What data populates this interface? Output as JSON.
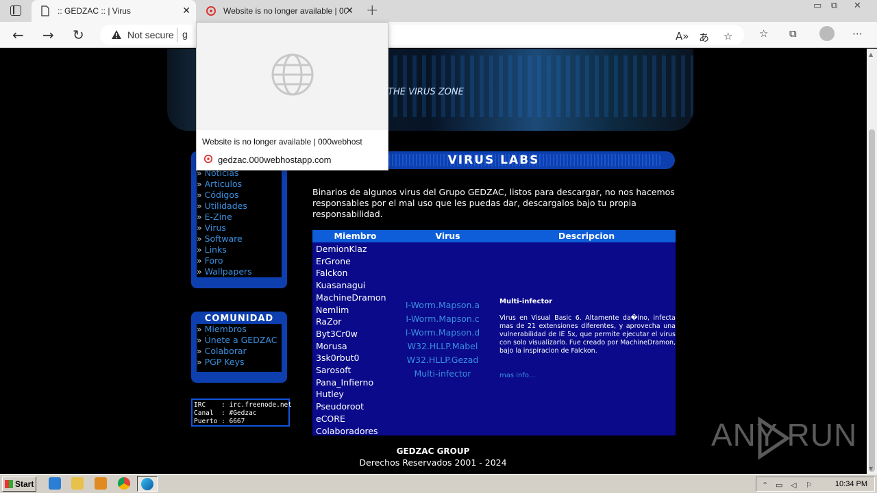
{
  "browser": {
    "tabs": [
      {
        "title": ":: GEDZAC :: | Virus",
        "active": true
      },
      {
        "title": "Website is no longer available | 000webhost",
        "active": false
      }
    ],
    "address": {
      "security_label": "Not secure",
      "url_visible": "g"
    },
    "hover_card": {
      "title": "Website is no longer available | 000webhost",
      "url": "gedzac.000webhostapp.com"
    }
  },
  "site": {
    "banner_text": "THE VIRUS ZONE",
    "sidebar": {
      "menu": [
        "Noticias",
        "Articulos",
        "Códigos",
        "Utilidades",
        "E-Zine",
        "Virus",
        "Software",
        "Links",
        "Foro",
        "Wallpapers"
      ],
      "community_title": "COMUNIDAD",
      "community": [
        "Miembros",
        "Únete a GEDZAC",
        "Colaborar",
        "PGP Keys"
      ],
      "irc": {
        "line1": "IRC    : irc.freenode.net",
        "line2": "Canal  : #Gedzac",
        "line3": "Puerto : 6667"
      }
    },
    "main": {
      "title": "VIRUS LABS",
      "intro": "Binarios de algunos virus del Grupo GEDZAC, listos para descargar, no nos hacemos responsables por el mal uso que les puedas dar, descargalos bajo tu propia responsabilidad.",
      "table": {
        "headers": [
          "Miembro",
          "Virus",
          "Descripcion"
        ],
        "members": [
          "DemionKlaz",
          "ErGrone",
          "Falckon",
          "Kuasanagui",
          "MachineDramon",
          "Nemlim",
          "RaZor",
          "Byt3Cr0w",
          "Morusa",
          "3sk0rbut0",
          "Sarosoft",
          "Pana_Infierno",
          "Hutley",
          "Pseudoroot",
          "eCORE",
          "Colaboradores"
        ],
        "viruses": [
          "I-Worm.Mapson.a",
          "I-Worm.Mapson.c",
          "I-Worm.Mapson.d",
          "W32.HLLP.Mabel",
          "W32.HLLP.Gezad",
          "Multi-infector"
        ],
        "description": {
          "title": "Multi-infector",
          "text": "Virus en Visual Basic 6. Altamente da�ino, infecta mas de 21 extensiones diferentes, y aprovecha una vulnerabilidad de IE 5x, que permite ejecutar el virus con solo visualizarlo. Fue creado por MachineDramon, bajo la inspiracion de Falckon.",
          "more": "mas info..."
        }
      }
    },
    "footer": {
      "group": "GEDZAC GROUP",
      "rights": "Derechos Reservados 2001 - 2024"
    }
  },
  "watermark": "ANY  RUN",
  "taskbar": {
    "start_label": "Start",
    "clock": "10:34 PM"
  }
}
